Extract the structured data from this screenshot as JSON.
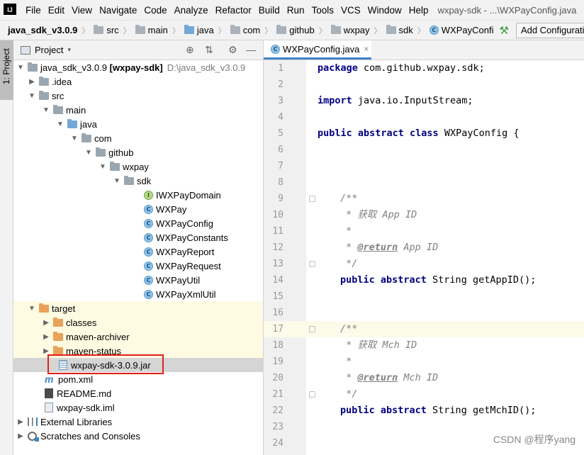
{
  "menubar": {
    "logo": "IJ",
    "items": [
      "File",
      "Edit",
      "View",
      "Navigate",
      "Code",
      "Analyze",
      "Refactor",
      "Build",
      "Run",
      "Tools",
      "VCS",
      "Window",
      "Help"
    ],
    "window_title": "wxpay-sdk - ...\\WXPayConfig.java"
  },
  "navbar": {
    "project": "java_sdk_v3.0.9",
    "crumbs": [
      "src",
      "main",
      "java",
      "com",
      "github",
      "wxpay",
      "sdk"
    ],
    "file": "WXPayConfi",
    "add_config_label": "Add Configuration..."
  },
  "tool_strip": {
    "project_tab": "1: Project"
  },
  "panel": {
    "title": "Project",
    "dropdown": "▾"
  },
  "tree": {
    "root_name": "java_sdk_v3.0.9",
    "root_module": "[wxpay-sdk]",
    "root_path": "D:\\java_sdk_v3.0.9",
    "idea": ".idea",
    "src": "src",
    "main": "main",
    "java": "java",
    "com": "com",
    "github": "github",
    "wxpay": "wxpay",
    "sdk": "sdk",
    "classes_list": [
      "IWXPayDomain",
      "WXPay",
      "WXPayConfig",
      "WXPayConstants",
      "WXPayReport",
      "WXPayRequest",
      "WXPayUtil",
      "WXPayXmlUtil"
    ],
    "target": "target",
    "target_classes": "classes",
    "maven_archiver": "maven-archiver",
    "maven_status": "maven-status",
    "jar": "wxpay-sdk-3.0.9.jar",
    "pom": "pom.xml",
    "readme": "README.md",
    "iml": "wxpay-sdk.iml",
    "external_libraries": "External Libraries",
    "scratches": "Scratches and Consoles"
  },
  "editor": {
    "tab_label": "WXPayConfig.java",
    "tab_close": "×",
    "lines": [
      {
        "n": "1"
      },
      {
        "n": "2"
      },
      {
        "n": "3"
      },
      {
        "n": "4"
      },
      {
        "n": "5"
      },
      {
        "n": "6"
      },
      {
        "n": "7"
      },
      {
        "n": "8"
      },
      {
        "n": "9"
      },
      {
        "n": "10"
      },
      {
        "n": "11"
      },
      {
        "n": "12"
      },
      {
        "n": "13"
      },
      {
        "n": "14"
      },
      {
        "n": "15"
      },
      {
        "n": "16"
      },
      {
        "n": "17"
      },
      {
        "n": "18"
      },
      {
        "n": "19"
      },
      {
        "n": "20"
      },
      {
        "n": "21"
      },
      {
        "n": "22"
      },
      {
        "n": "23"
      },
      {
        "n": "24"
      }
    ],
    "code": {
      "l1_kw": "package",
      "l1_rest": " com.github.wxpay.sdk;",
      "l3_kw": "import",
      "l3_rest": " java.io.InputStream;",
      "l5_kw": "public abstract class",
      "l5_rest": " WXPayConfig {",
      "l9": "/**",
      "l10": " * 获取 App ID",
      "l11": " *",
      "l12_star": " * ",
      "l12_tag": "@return",
      "l12_rest": " App ID",
      "l13": " */",
      "l14_kw": "public abstract",
      "l14_rest": " String getAppID();",
      "l17": "/**",
      "l18": " * 获取 Mch ID",
      "l19": " *",
      "l20_star": " * ",
      "l20_tag": "@return",
      "l20_rest": " Mch ID",
      "l21": " */",
      "l22_kw": "public abstract",
      "l22_rest": " String getMchID();"
    }
  },
  "watermark": "CSDN @程序yang"
}
